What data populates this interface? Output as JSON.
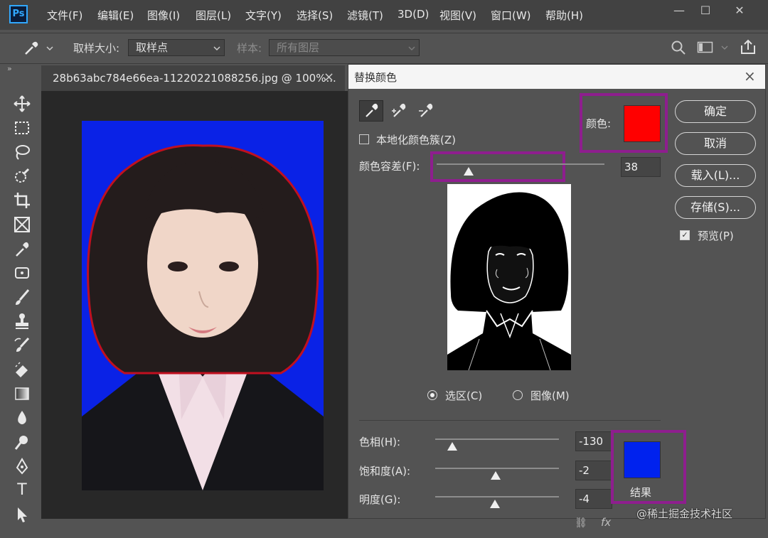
{
  "app": {
    "logo": "Ps",
    "menu": [
      "文件(F)",
      "编辑(E)",
      "图像(I)",
      "图层(L)",
      "文字(Y)",
      "选择(S)",
      "滤镜(T)",
      "3D(D)",
      "视图(V)",
      "窗口(W)",
      "帮助(H)"
    ],
    "window_controls": {
      "minimize": "—",
      "maximize": "☐",
      "close": "✕"
    }
  },
  "options_bar": {
    "sample_size_label": "取样大小:",
    "sample_size_value": "取样点",
    "sample_label": "样本:",
    "sample_value": "所有图层"
  },
  "document": {
    "tab_title": "28b63abc784e66ea-11220221088256.jpg @ 100%...",
    "close": "×"
  },
  "toolbar": {
    "collapse": "»",
    "tools": [
      "move-tool",
      "marquee-tool",
      "lasso-tool",
      "quick-select-tool",
      "crop-tool",
      "frame-tool",
      "eyedropper-tool",
      "healing-tool",
      "brush-tool",
      "stamp-tool",
      "history-brush-tool",
      "eraser-tool",
      "gradient-tool",
      "blur-tool",
      "dodge-tool",
      "pen-tool",
      "type-tool",
      "path-select-tool"
    ],
    "type_glyph": "T"
  },
  "dialog": {
    "title": "替换颜色",
    "close": "×",
    "localized_clusters_label": "本地化颜色簇(Z)",
    "localized_clusters_checked": false,
    "color_label": "颜色:",
    "selected_color": "#ff0000",
    "fuzziness_label": "颜色容差(F):",
    "fuzziness_value": "38",
    "fuzziness_fraction": 0.19,
    "radio_selection": "选区(C)",
    "radio_image": "图像(M)",
    "selected_mode": "selection",
    "buttons": {
      "ok": "确定",
      "cancel": "取消",
      "load": "载入(L)...",
      "save": "存储(S)..."
    },
    "preview_label": "预览(P)",
    "preview_checked": true,
    "hue_label": "色相(H):",
    "hue_value": "-130",
    "hue_fraction": 0.14,
    "saturation_label": "饱和度(A):",
    "saturation_value": "-2",
    "saturation_fraction": 0.49,
    "lightness_label": "明度(G):",
    "lightness_value": "-4",
    "lightness_fraction": 0.48,
    "result_label": "结果",
    "result_color": "#0022ee"
  },
  "watermark": "@稀土掘金技术社区",
  "colors": {
    "menubar": "#424242",
    "panel": "#535353",
    "canvas": "#282828",
    "photo_background": "#0a22e6",
    "highlight": "#8e1e8e"
  }
}
